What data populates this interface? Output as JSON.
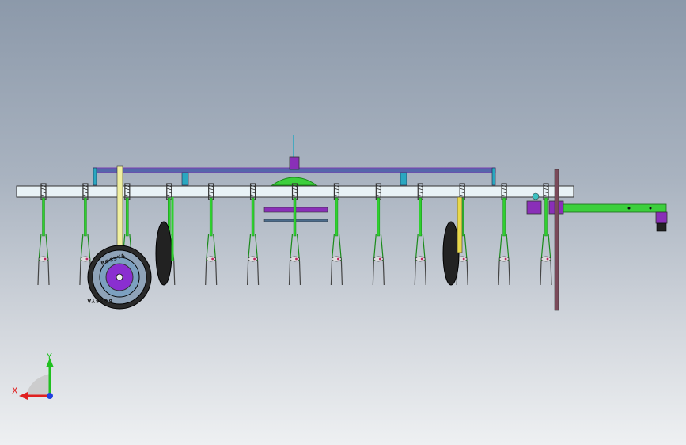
{
  "viewport": {
    "background_top": "#8c99aa",
    "background_bottom": "#eef0f2"
  },
  "model": {
    "colors": {
      "frame_bar": "#e8f2f6",
      "subframe": "#7a3fb0",
      "subframe_fill": "#5566aa",
      "shank": "#2fd02f",
      "shank_dark": "#1a8a1a",
      "spring": "#333333",
      "hitch_bar": "#3ccf3c",
      "bracket": "#8a2fb8",
      "wheel_hub": "#8a2fd0",
      "tire": "#222222",
      "marker_post": "#7a4a5a",
      "teal_bracket": "#2aa7c0",
      "yellow_strut": "#e8d84a"
    },
    "tine_count": 13,
    "gauge_wheel_label": "BOSSYA",
    "gauge_wheel_label_flipped": "BOSSYA"
  },
  "triad": {
    "x_label": "X",
    "y_label": "Y",
    "x_color": "#e02020",
    "y_color": "#20c020",
    "z_color": "#2040e0"
  }
}
